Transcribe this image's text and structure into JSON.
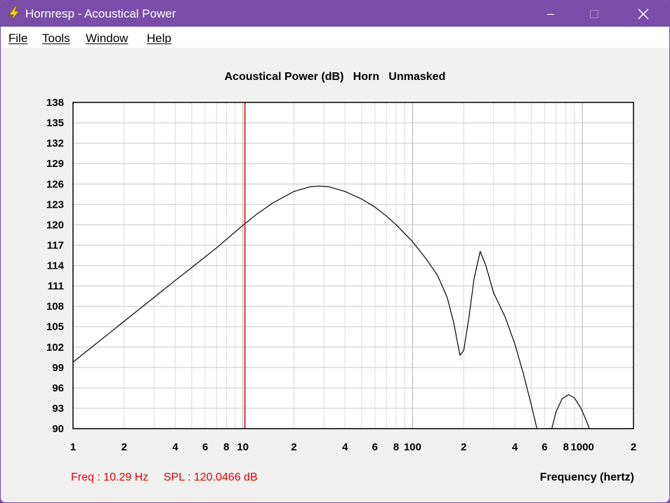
{
  "window": {
    "title": "Hornresp - Acoustical Power",
    "app_icon": "lightning-bolt-icon",
    "controls": [
      "minimize-icon",
      "maximize-icon",
      "close-icon"
    ]
  },
  "menu": [
    {
      "label": "File"
    },
    {
      "label": "Tools"
    },
    {
      "label": "Window"
    },
    {
      "label": "Help"
    }
  ],
  "status": {
    "freq": "Freq : 10.29 Hz",
    "spl": "SPL : 120.0466 dB"
  },
  "colors": {
    "titlebar": "#7a4ea8",
    "cursor": "#e00000",
    "status_text": "#e00000",
    "curve": "#000000",
    "grid": "#c8c8c8"
  },
  "chart_data": {
    "type": "line",
    "title": "Acoustical Power (dB)   Horn   Unmasked",
    "xlabel": "Frequency (hertz)",
    "ylabel": "",
    "x_scale": "log",
    "xlim": [
      1,
      2000
    ],
    "ylim": [
      90,
      138
    ],
    "y_ticks": [
      138,
      135,
      132,
      129,
      126,
      123,
      120,
      117,
      114,
      111,
      108,
      105,
      102,
      99,
      96,
      93,
      90
    ],
    "x_ticks": [
      {
        "value": 1,
        "label": "1"
      },
      {
        "value": 2,
        "label": "2"
      },
      {
        "value": 4,
        "label": "4"
      },
      {
        "value": 6,
        "label": "6"
      },
      {
        "value": 8,
        "label": "8"
      },
      {
        "value": 10,
        "label": "10"
      },
      {
        "value": 20,
        "label": "2"
      },
      {
        "value": 40,
        "label": "4"
      },
      {
        "value": 60,
        "label": "6"
      },
      {
        "value": 80,
        "label": "8"
      },
      {
        "value": 100,
        "label": "100"
      },
      {
        "value": 200,
        "label": "2"
      },
      {
        "value": 400,
        "label": "4"
      },
      {
        "value": 600,
        "label": "6"
      },
      {
        "value": 800,
        "label": "8"
      },
      {
        "value": 1000,
        "label": "1000"
      },
      {
        "value": 2000,
        "label": "2"
      }
    ],
    "grid": true,
    "cursor_x": 10.29,
    "series": [
      {
        "segments": [
          [
            [
              1,
              99.8
            ],
            [
              1.5,
              103.3
            ],
            [
              2,
              105.8
            ],
            [
              3,
              109.3
            ],
            [
              4,
              111.8
            ],
            [
              5,
              113.7
            ],
            [
              7,
              116.6
            ],
            [
              10,
              119.9
            ],
            [
              12,
              121.5
            ],
            [
              15,
              123.2
            ],
            [
              20,
              124.9
            ],
            [
              25,
              125.6
            ],
            [
              28,
              125.7
            ],
            [
              32,
              125.6
            ],
            [
              40,
              124.9
            ],
            [
              50,
              123.8
            ],
            [
              60,
              122.6
            ],
            [
              70,
              121.3
            ],
            [
              80,
              120.0
            ],
            [
              100,
              117.5
            ],
            [
              120,
              115.0
            ],
            [
              140,
              112.6
            ],
            [
              160,
              109.3
            ],
            [
              175,
              105.5
            ],
            [
              190,
              100.8
            ],
            [
              200,
              101.5
            ],
            [
              215,
              106.5
            ],
            [
              230,
              112.0
            ],
            [
              250,
              116.1
            ],
            [
              270,
              114.0
            ],
            [
              300,
              110.0
            ],
            [
              350,
              106.5
            ],
            [
              400,
              102.5
            ],
            [
              450,
              98.0
            ],
            [
              500,
              93.5
            ],
            [
              540,
              90.0
            ]
          ],
          [
            [
              660,
              90.0
            ],
            [
              700,
              92.5
            ],
            [
              760,
              94.4
            ],
            [
              830,
              95.0
            ],
            [
              900,
              94.5
            ],
            [
              980,
              93.0
            ],
            [
              1050,
              91.3
            ],
            [
              1100,
              90.0
            ]
          ]
        ]
      }
    ]
  }
}
